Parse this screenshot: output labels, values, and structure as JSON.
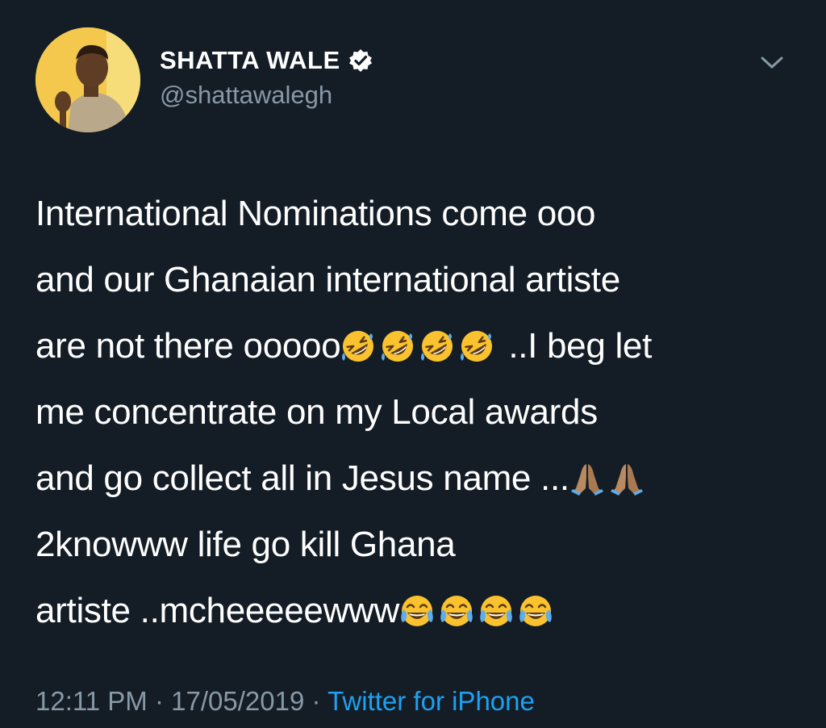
{
  "tweet": {
    "display_name": "SHATTA WALE",
    "handle": "@shattawalegh",
    "lines": [
      {
        "text": "International Nominations come ooo"
      },
      {
        "text": "and our Ghanaian international artiste"
      },
      {
        "text_before": "are not there ooooo",
        "emoji": "rofl",
        "emoji_count": 4,
        "text_after": " ..I beg let"
      },
      {
        "text": "me concentrate on my Local awards"
      },
      {
        "text_before": "and go collect all in Jesus name ...",
        "emoji": "folded-hands",
        "emoji_count": 2,
        "text_after": ""
      },
      {
        "text": "2knowww life go kill Ghana"
      },
      {
        "text_before": "artiste ..mcheeeeewww",
        "emoji": "tears-of-joy",
        "emoji_count": 4,
        "text_after": ""
      }
    ],
    "time": "12:11 PM",
    "separator": "·",
    "date": "17/05/2019",
    "source": "Twitter for iPhone"
  },
  "colors": {
    "background": "#141d26",
    "text": "#ffffff",
    "muted": "#8899a6",
    "link": "#1da1f2"
  },
  "icons": {
    "verified": "verified-badge-icon",
    "menu": "chevron-down-icon"
  }
}
